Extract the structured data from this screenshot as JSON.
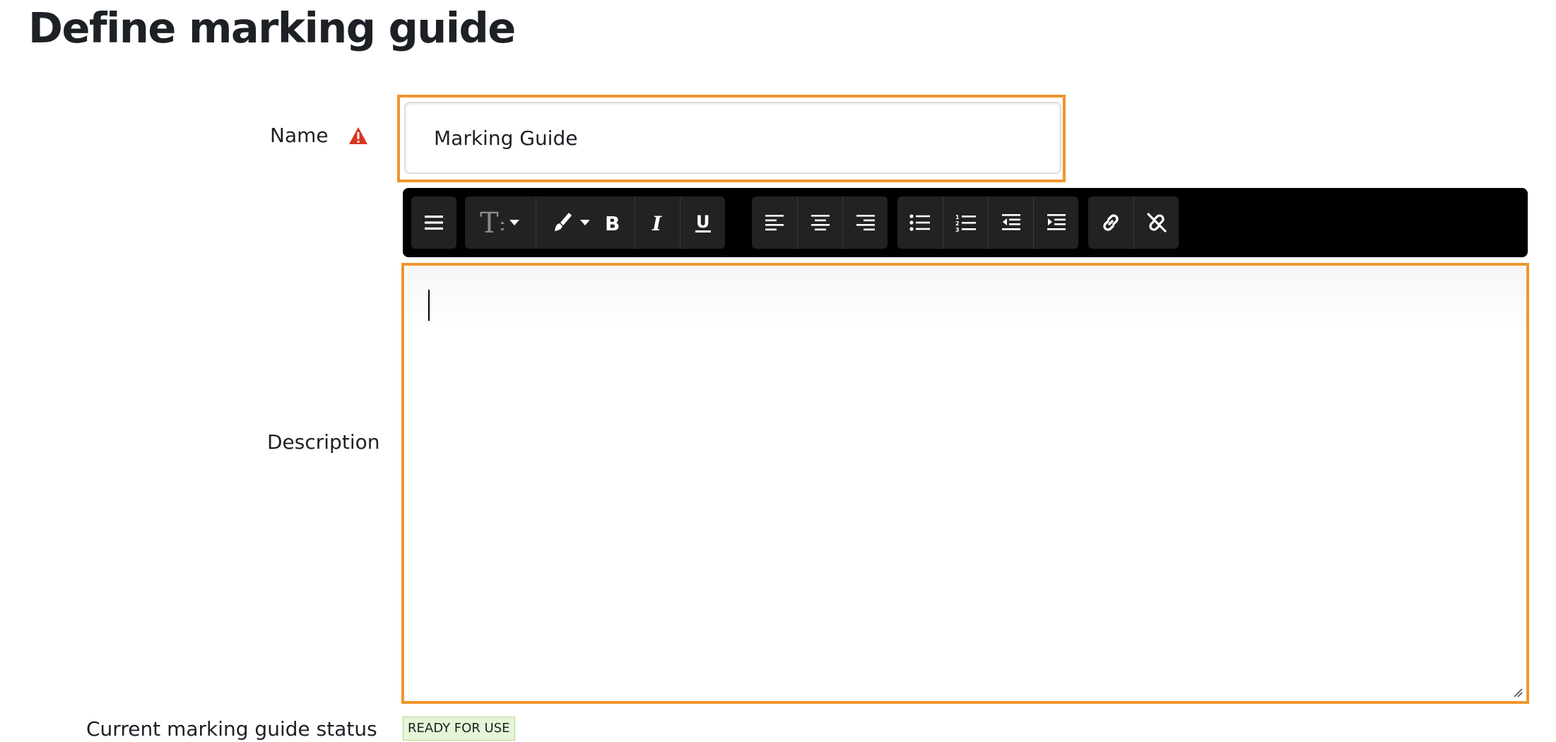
{
  "page_title": "Define marking guide",
  "form": {
    "name_label": "Name",
    "name_value": "Marking Guide",
    "description_label": "Description",
    "status_label": "Current marking guide status",
    "status_badge": "READY FOR USE"
  },
  "toolbar": {
    "groups": [
      [
        "menu-icon"
      ],
      [
        "font-size-icon",
        "brush-icon"
      ],
      [
        "bold-icon",
        "italic-icon",
        "underline-icon"
      ],
      [
        "align-left-icon",
        "align-center-icon",
        "align-right-icon"
      ],
      [
        "bullet-list-icon",
        "numbered-list-icon",
        "outdent-icon",
        "indent-icon"
      ],
      [
        "link-icon",
        "unlink-icon"
      ]
    ]
  },
  "colors": {
    "highlight": "#f0952e",
    "required": "#d9341f",
    "toolbar_bg": "#000000",
    "badge_bg": "#e6f4d8"
  }
}
